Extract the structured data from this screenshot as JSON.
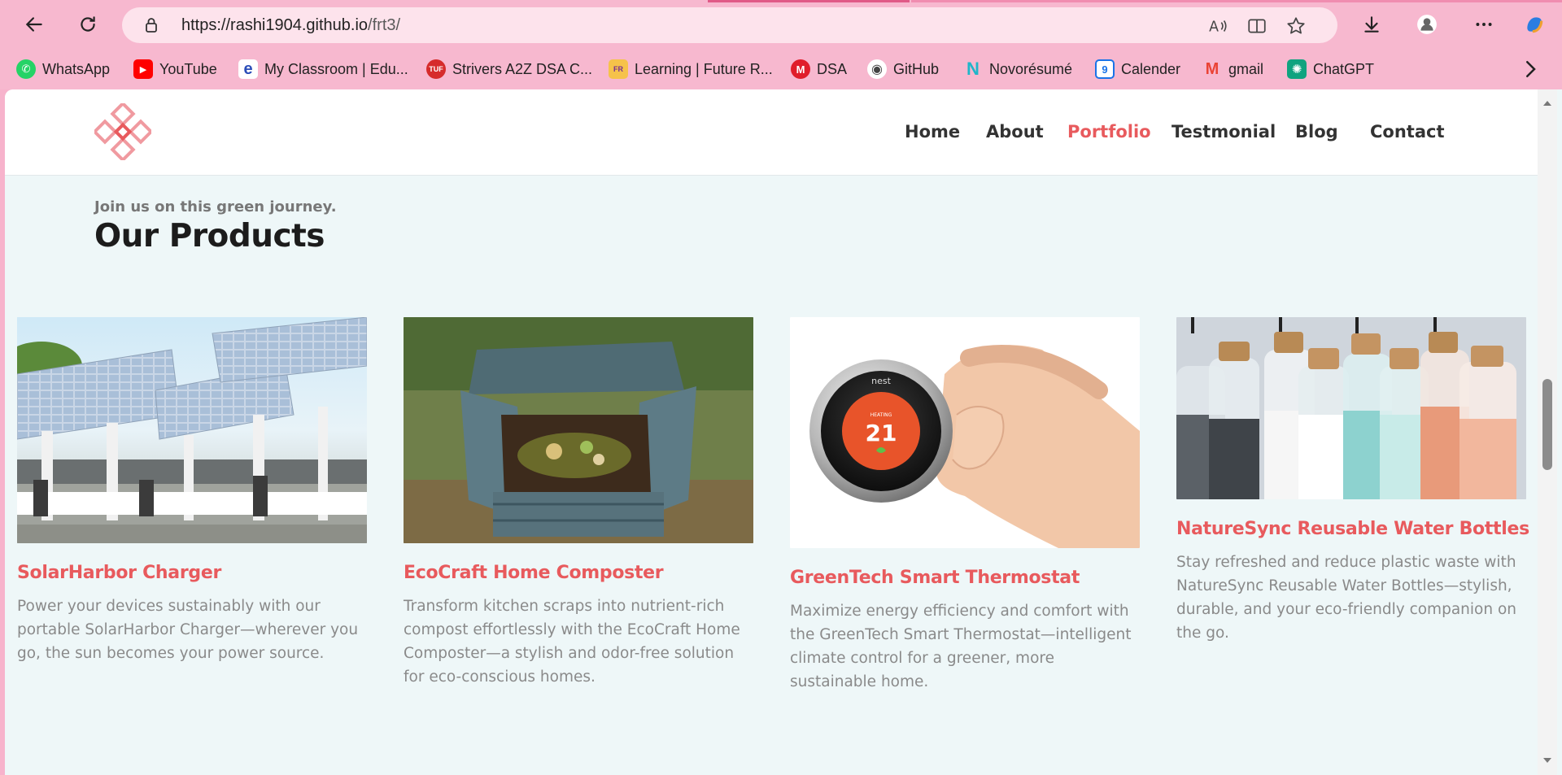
{
  "browser": {
    "url_host": "https://rashi1904.github.io",
    "url_path": "/frt3/",
    "bookmarks": [
      {
        "label": "WhatsApp",
        "color": "#25d366",
        "glyph": "✆"
      },
      {
        "label": "YouTube",
        "color": "#ff0000",
        "glyph": "▶"
      },
      {
        "label": "My Classroom | Edu...",
        "color": "#2b4db8",
        "glyph": "e"
      },
      {
        "label": "Strivers A2Z DSA C...",
        "color": "#d62b2b",
        "glyph": "T"
      },
      {
        "label": "Learning | Future R...",
        "color": "#e96b2a",
        "glyph": "F"
      },
      {
        "label": "DSA",
        "color": "#e01e2b",
        "glyph": "M"
      },
      {
        "label": "GitHub",
        "color": "#6a6a6a",
        "glyph": "◉"
      },
      {
        "label": "Novorésumé",
        "color": "#1fb6c9",
        "glyph": "N"
      },
      {
        "label": "Calender",
        "color": "#1a73e8",
        "glyph": "9"
      },
      {
        "label": "gmail",
        "color": "#ea4335",
        "glyph": "M"
      },
      {
        "label": "ChatGPT",
        "color": "#10a37f",
        "glyph": "✺"
      }
    ]
  },
  "site": {
    "nav": [
      "Home",
      "About",
      "Portfolio",
      "Testmonial",
      "Blog",
      "Contact"
    ],
    "active_nav": "Portfolio",
    "accent_color": "#e85a5d"
  },
  "products_section": {
    "eyebrow": "Join us on this green journey.",
    "title": "Our Products",
    "items": [
      {
        "name": "SolarHarbor Charger",
        "description": "Power your devices sustainably with our portable SolarHarbor Charger—wherever you go, the sun becomes your power source.",
        "image": "solar-carport-photo"
      },
      {
        "name": "EcoCraft Home Composter",
        "description": "Transform kitchen scraps into nutrient-rich compost effortlessly with the EcoCraft Home Composter—a stylish and odor-free solution for eco-conscious homes.",
        "image": "compost-bin-photo"
      },
      {
        "name": "GreenTech Smart Thermostat",
        "description": "Maximize energy efficiency and comfort with the GreenTech Smart Thermostat—intelligent climate control for a greener, more sustainable home.",
        "image": "thermostat-photo",
        "thermostat_brand": "nest",
        "thermostat_mode": "HEATING",
        "thermostat_temp": "21"
      },
      {
        "name": "NatureSync Reusable Water Bottles",
        "description": "Stay refreshed and reduce plastic waste with NatureSync Reusable Water Bottles—stylish, durable, and your eco-friendly companion on the go.",
        "image": "water-bottles-photo"
      }
    ]
  }
}
